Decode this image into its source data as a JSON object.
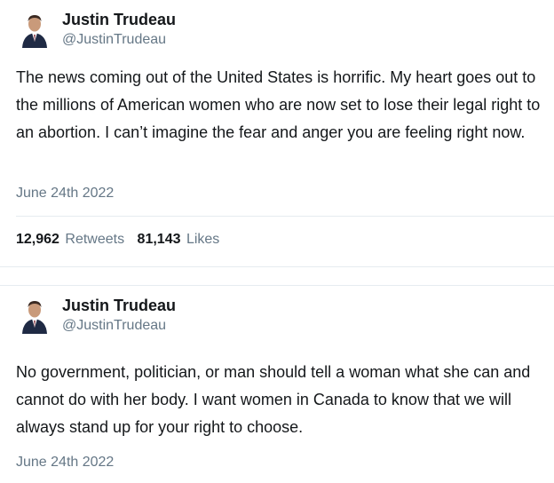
{
  "tweets": [
    {
      "author_name": "Justin Trudeau",
      "author_handle": "@JustinTrudeau",
      "text": "The news coming out of the United States is horrific. My heart goes out to the millions of American women who are now set to lose their legal right to an abortion. I can’t imagine the fear and anger you are feeling right now.",
      "date": "June 24th 2022",
      "retweets_count": "12,962",
      "retweets_label": "Retweets",
      "likes_count": "81,143",
      "likes_label": "Likes"
    },
    {
      "author_name": "Justin Trudeau",
      "author_handle": "@JustinTrudeau",
      "text": "No government, politician, or man should tell a woman what she can and cannot do with her body. I want women in Canada to know that we will always stand up for your right to choose.",
      "date": "June 24th 2022"
    }
  ],
  "colors": {
    "text": "#14171a",
    "secondary": "#657786",
    "divider": "#e6ecf0"
  }
}
